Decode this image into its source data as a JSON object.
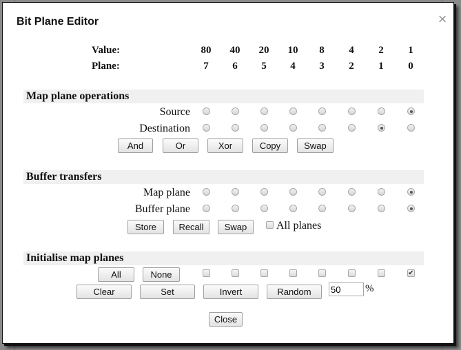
{
  "dialog": {
    "title": "Bit Plane Editor",
    "close_icon": "close-x-icon"
  },
  "header": {
    "value_label": "Value:",
    "plane_label": "Plane:",
    "values": [
      "80",
      "40",
      "20",
      "10",
      "8",
      "4",
      "2",
      "1"
    ],
    "planes": [
      "7",
      "6",
      "5",
      "4",
      "3",
      "2",
      "1",
      "0"
    ]
  },
  "map_ops": {
    "title": "Map plane operations",
    "source_label": "Source",
    "destination_label": "Destination",
    "source_selected_plane": 0,
    "destination_selected_plane": 1,
    "buttons": [
      "And",
      "Or",
      "Xor",
      "Copy",
      "Swap"
    ]
  },
  "buffer": {
    "title": "Buffer transfers",
    "map_plane_label": "Map plane",
    "buffer_plane_label": "Buffer plane",
    "map_plane_selected": 0,
    "buffer_plane_selected": 0,
    "buttons": [
      "Store",
      "Recall",
      "Swap"
    ],
    "all_planes_label": "All planes",
    "all_planes_checked": false
  },
  "init": {
    "title": "Initialise map planes",
    "all_label": "All",
    "none_label": "None",
    "plane_checked": [
      false,
      false,
      false,
      false,
      false,
      false,
      false,
      true
    ],
    "buttons": [
      "Clear",
      "Set",
      "Invert",
      "Random"
    ],
    "random_percent": "50",
    "percent_sign": "%"
  },
  "footer": {
    "close_label": "Close"
  }
}
